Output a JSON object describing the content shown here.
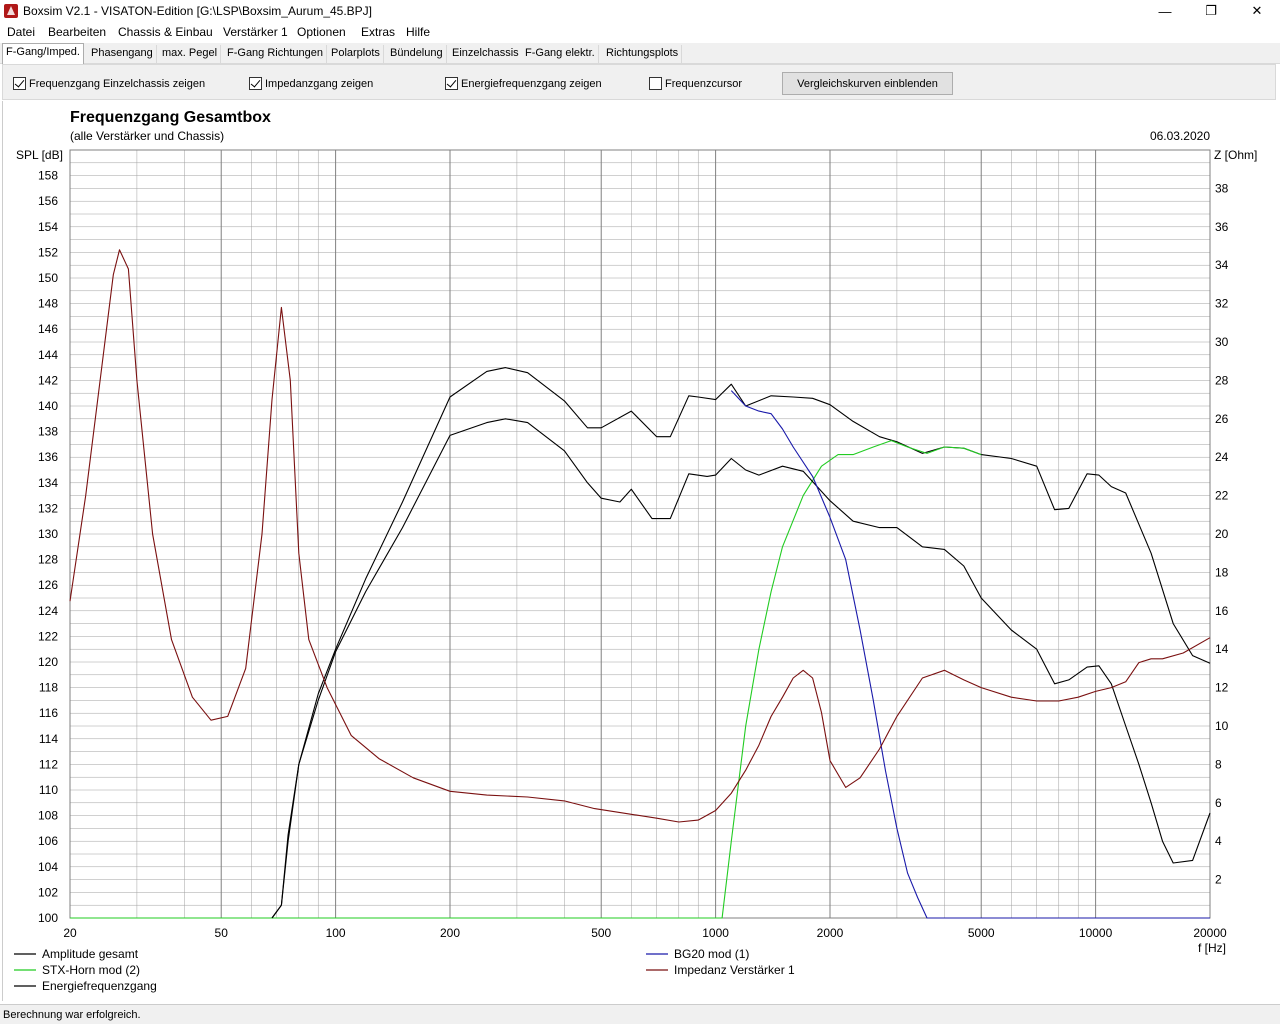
{
  "window": {
    "title": "Boxsim V2.1 - VISATON-Edition [G:\\LSP\\Boxsim_Aurum_45.BPJ]",
    "min_glyph": "—",
    "max_glyph": "❐",
    "close_glyph": "✕"
  },
  "menu": [
    "Datei",
    "Bearbeiten",
    "Chassis & Einbau",
    "Verstärker 1",
    "Optionen",
    "Extras",
    "Hilfe"
  ],
  "tabs": [
    "F-Gang/Imped.",
    "Phasengang",
    "max. Pegel",
    "F-Gang Richtungen",
    "Polarplots",
    "Bündelung",
    "Einzelchassis",
    "F-Gang elektr.",
    "Richtungsplots"
  ],
  "active_tab": 0,
  "options": {
    "einzelchassis": {
      "label": "Frequenzgang Einzelchassis zeigen",
      "checked": true
    },
    "impedanz": {
      "label": "Impedanzgang zeigen",
      "checked": true
    },
    "energie": {
      "label": "Energiefrequenzgang zeigen",
      "checked": true
    },
    "cursor": {
      "label": "Frequenzcursor",
      "checked": false
    },
    "compare_button": "Vergleichskurven einblenden"
  },
  "status": "Berechnung war erfolgreich.",
  "colors": {
    "amplitude": "#000000",
    "horn": "#22cc22",
    "energy": "#000000",
    "bg20": "#1a1aaa",
    "impedance": "#7a1010",
    "grid": "#a0a0a0"
  },
  "chart_data": {
    "type": "line",
    "title": "Frequenzgang Gesamtbox",
    "subtitle": "(alle Verstärker und Chassis)",
    "date": "06.03.2020",
    "ylabel": "SPL [dB]",
    "y2label": "Z [Ohm]",
    "xlabel": "f [Hz]",
    "x_scale": "log",
    "xlim": [
      20,
      20000
    ],
    "ylim": [
      100,
      160
    ],
    "y2lim": [
      0,
      40
    ],
    "x_ticks": [
      20,
      50,
      100,
      200,
      500,
      1000,
      2000,
      5000,
      10000,
      20000
    ],
    "y_ticks": [
      100,
      102,
      104,
      106,
      108,
      110,
      112,
      114,
      116,
      118,
      120,
      122,
      124,
      126,
      128,
      130,
      132,
      134,
      136,
      138,
      140,
      142,
      144,
      146,
      148,
      150,
      152,
      154,
      156,
      158
    ],
    "y2_ticks": [
      2,
      4,
      6,
      8,
      10,
      12,
      14,
      16,
      18,
      20,
      22,
      24,
      26,
      28,
      30,
      32,
      34,
      36,
      38
    ],
    "grid": true,
    "legend_position": "bottom",
    "series": [
      {
        "name": "Amplitude gesamt",
        "axis": "left",
        "colorKey": "amplitude",
        "x": [
          68,
          72,
          75,
          80,
          90,
          100,
          120,
          150,
          200,
          250,
          280,
          320,
          400,
          460,
          500,
          600,
          700,
          760,
          850,
          900,
          1000,
          1100,
          1200,
          1400,
          1600,
          1800,
          2000,
          2300,
          2700,
          3000,
          3500,
          4000,
          4500,
          5000,
          6000,
          7000,
          7800,
          8500,
          9500,
          10200,
          11000,
          12000,
          14000,
          16000,
          18000,
          20000
        ],
        "y": [
          100,
          101,
          106,
          112,
          117.5,
          121,
          126.5,
          132.5,
          140.7,
          142.7,
          143,
          142.6,
          140.4,
          138.3,
          138.3,
          139.6,
          137.6,
          137.6,
          140.8,
          140.7,
          140.5,
          141.7,
          140,
          140.8,
          140.7,
          140.6,
          140.1,
          138.8,
          137.6,
          137.2,
          136.3,
          136.8,
          136.7,
          136.2,
          135.9,
          135.3,
          131.9,
          132,
          134.7,
          134.6,
          133.7,
          133.2,
          128.5,
          123,
          120.5,
          119.9
        ]
      },
      {
        "name": "STX-Horn mod (2)",
        "axis": "left",
        "colorKey": "horn",
        "x": [
          20,
          1040,
          1100,
          1200,
          1300,
          1400,
          1500,
          1700,
          1900,
          2100,
          2300,
          2600,
          2900,
          3200,
          3600,
          4000,
          4500,
          5000
        ],
        "y": [
          100,
          100,
          106,
          115,
          121,
          125.5,
          129,
          133,
          135.3,
          136.2,
          136.2,
          136.8,
          137.3,
          136.8,
          136.3,
          136.8,
          136.7,
          136.2
        ]
      },
      {
        "name": "Energiefrequenzgang",
        "axis": "left",
        "colorKey": "energy",
        "x": [
          68,
          72,
          75,
          80,
          90,
          100,
          120,
          150,
          200,
          250,
          280,
          320,
          400,
          460,
          500,
          560,
          600,
          680,
          760,
          850,
          950,
          1000,
          1100,
          1200,
          1300,
          1500,
          1700,
          2000,
          2300,
          2700,
          3000,
          3500,
          4000,
          4500,
          5000,
          6000,
          7000,
          7800,
          8500,
          9500,
          10200,
          11000,
          12000,
          13000,
          14000,
          15000,
          16000,
          18000,
          20000
        ],
        "y": [
          100,
          101,
          106.5,
          112,
          117,
          120.8,
          125.5,
          130.5,
          137.7,
          138.7,
          139,
          138.7,
          136.5,
          134,
          132.8,
          132.5,
          133.5,
          131.2,
          131.2,
          134.7,
          134.5,
          134.6,
          135.9,
          135,
          134.6,
          135.3,
          134.9,
          132.6,
          131,
          130.5,
          130.5,
          129,
          128.8,
          127.5,
          125,
          122.5,
          121,
          118.3,
          118.6,
          119.6,
          119.7,
          118.3,
          115,
          112,
          109,
          106,
          104.3,
          104.5,
          108.2
        ]
      },
      {
        "name": "BG20 mod (1)",
        "axis": "left",
        "colorKey": "bg20",
        "x": [
          1100,
          1200,
          1300,
          1400,
          1500,
          1600,
          1800,
          2000,
          2200,
          2400,
          2600,
          2800,
          3000,
          3200,
          3400,
          3600,
          3800,
          20000
        ],
        "y": [
          141.2,
          140,
          139.6,
          139.4,
          138.2,
          136.8,
          134.5,
          131.3,
          128,
          122.5,
          117,
          111.5,
          107,
          103.5,
          101.6,
          100,
          100,
          100
        ]
      },
      {
        "name": "Impedanz Verstärker 1",
        "axis": "right",
        "colorKey": "impedance",
        "x": [
          20,
          22,
          24,
          26,
          27,
          28.5,
          30,
          33,
          37,
          42,
          47,
          52,
          58,
          64,
          68,
          72,
          76,
          80,
          85,
          95,
          110,
          130,
          160,
          200,
          250,
          320,
          400,
          480,
          600,
          700,
          800,
          900,
          1000,
          1100,
          1200,
          1300,
          1400,
          1500,
          1600,
          1700,
          1800,
          1900,
          2000,
          2200,
          2400,
          2700,
          3000,
          3500,
          4000,
          4500,
          5000,
          6000,
          7000,
          8000,
          9000,
          10000,
          11000,
          12000,
          13000,
          14000,
          15000,
          17000,
          20000
        ],
        "y": [
          16.5,
          22,
          28,
          33.5,
          34.8,
          33.8,
          28,
          20,
          14.5,
          11.5,
          10.3,
          10.5,
          13,
          20,
          27,
          31.8,
          28,
          19,
          14.5,
          12,
          9.5,
          8.3,
          7.3,
          6.6,
          6.4,
          6.3,
          6.1,
          5.7,
          5.4,
          5.2,
          5,
          5.1,
          5.6,
          6.5,
          7.7,
          9,
          10.5,
          11.5,
          12.5,
          12.9,
          12.5,
          10.7,
          8.2,
          6.8,
          7.3,
          8.8,
          10.5,
          12.5,
          12.9,
          12.4,
          12,
          11.5,
          11.3,
          11.3,
          11.5,
          11.8,
          12,
          12.3,
          13.3,
          13.5,
          13.5,
          13.8,
          14.6
        ]
      }
    ]
  }
}
